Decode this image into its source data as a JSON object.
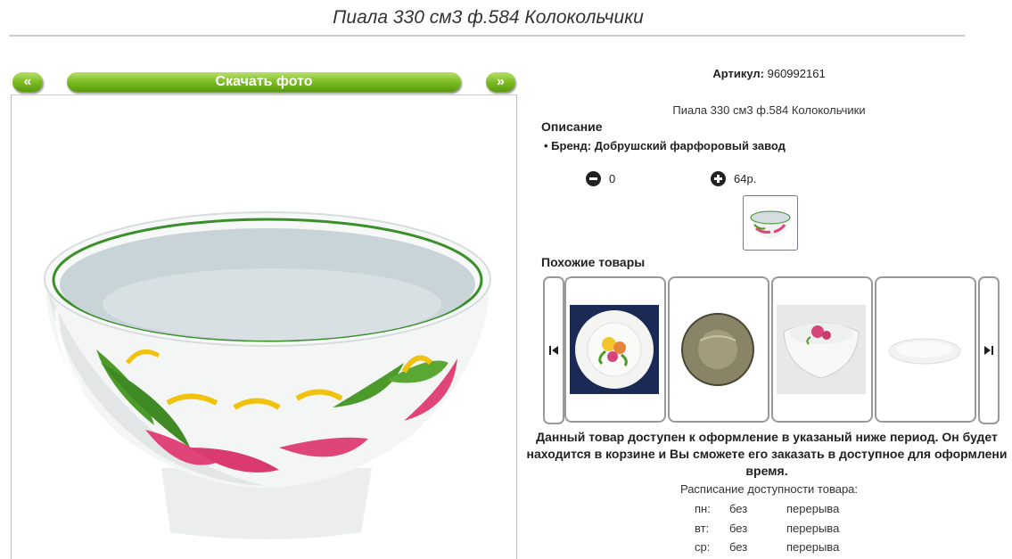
{
  "page_title": "Пиала 330 см3 ф.584 Колокольчики",
  "photo_nav": {
    "prev_label": "«",
    "download_label": "Скачать фото",
    "next_label": "»"
  },
  "article": {
    "label": "Артикул:",
    "value": "960992161"
  },
  "product_name": "Пиала 330 см3 ф.584 Колокольчики",
  "description": {
    "heading": "Описание",
    "brand": "Бренд: Добрушский фарфоровый завод"
  },
  "quantity": {
    "minus_value": "0",
    "plus_value": "64р."
  },
  "similar": {
    "heading": "Похожие товары",
    "items": [
      {
        "name": "floral-plate"
      },
      {
        "name": "smoked-glass-plate"
      },
      {
        "name": "square-floral-bowl"
      },
      {
        "name": "white-dish"
      }
    ]
  },
  "availability": {
    "line1": "Данный товар доступен к оформление в указаный ниже период. Он будет",
    "line2": "находится в корзине и Вы сможете его заказать в доступное для оформлени",
    "line3": "время."
  },
  "schedule": {
    "heading": "Расписание доступности товара:",
    "rows": [
      {
        "day": "пн:",
        "from": "без",
        "to": "перерыва"
      },
      {
        "day": "вт:",
        "from": "без",
        "to": "перерыва"
      },
      {
        "day": "ср:",
        "from": "без",
        "to": "перерыва"
      }
    ]
  },
  "colors": {
    "accent_green": "#7bbd22",
    "rim_green": "#3a8f2a",
    "flower_pink": "#e0457a"
  },
  "icons": [
    "minus-circle-icon",
    "plus-circle-icon",
    "arrow-left-icon",
    "arrow-right-icon"
  ]
}
